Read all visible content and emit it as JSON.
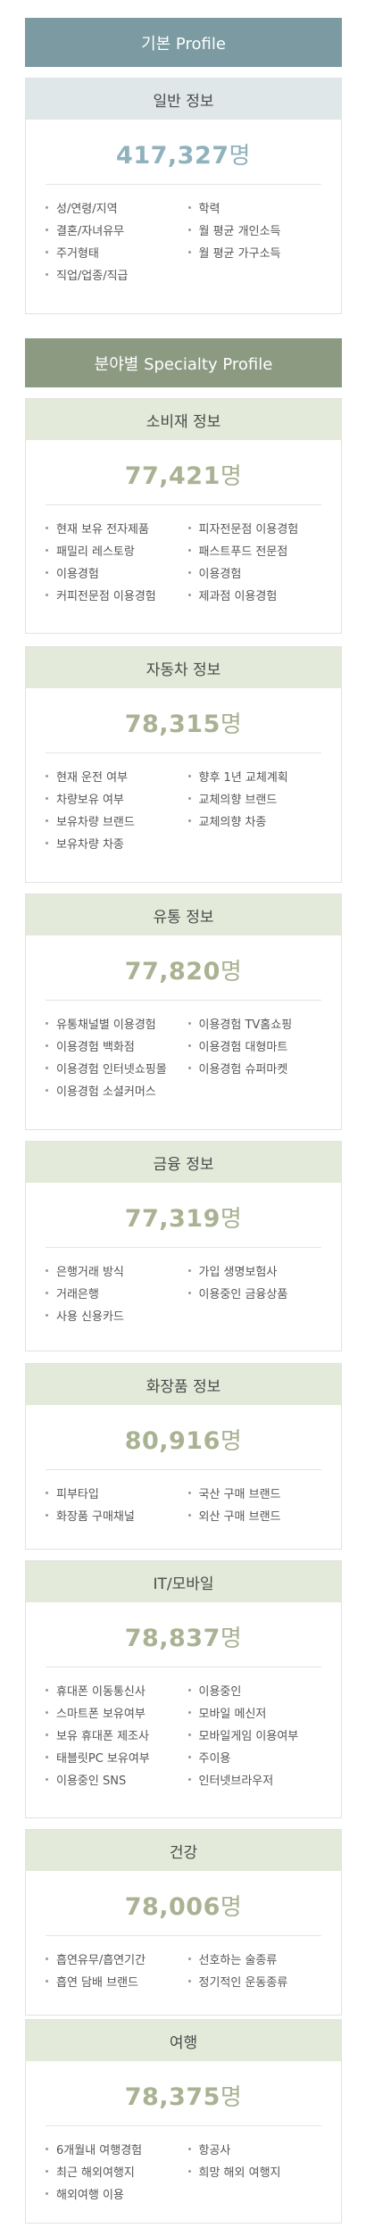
{
  "basic_banner": "기본 Profile",
  "specialty_banner": "분야별 Specialty Profile",
  "cards": [
    {
      "title": "일반 정보",
      "count": "417,327",
      "unit": "명",
      "items": [
        "성/연령/지역",
        "학력",
        "결혼/자녀유무",
        "월 평균 개인소득",
        "주거형태",
        "월 평균 가구소득",
        "직업/업종/직급"
      ]
    },
    {
      "title": "소비재 정보",
      "count": "77,421",
      "unit": "명",
      "items": [
        "현재 보유 전자제품",
        "피자전문점 이용경험",
        "패밀리 레스토랑",
        "패스트푸드 전문점",
        "이용경험",
        "이용경험",
        "커피전문점 이용경험",
        "제과점 이용경험"
      ]
    },
    {
      "title": "자동차 정보",
      "count": "78,315",
      "unit": "명",
      "items": [
        "현재 운전 여부",
        "향후 1년 교체계획",
        "차량보유 여부",
        "교체의향 브랜드",
        "보유차량 브랜드",
        "교체의향 차종",
        "보유차량 차종"
      ]
    },
    {
      "title": "유통 정보",
      "count": "77,820",
      "unit": "명",
      "items": [
        "유통채널별 이용경험",
        "이용경험 TV홈쇼핑",
        "이용경험 백화점",
        "이용경험 대형마트",
        "이용경험 인터넷쇼핑몰",
        "이용경험 슈퍼마켓",
        "이용경험 소셜커머스"
      ]
    },
    {
      "title": "금융 정보",
      "count": "77,319",
      "unit": "명",
      "items": [
        "은행거래 방식",
        "가입 생명보험사",
        "거래은행",
        "이용중인 금융상품",
        "사용 신용카드"
      ]
    },
    {
      "title": "화장품 정보",
      "count": "80,916",
      "unit": "명",
      "items": [
        "피부타입",
        "국산 구매 브랜드",
        "화장품 구매채널",
        "외산 구매 브랜드"
      ]
    },
    {
      "title": "IT/모바일",
      "count": "78,837",
      "unit": "명",
      "items": [
        "휴대폰 이동통신사",
        "이용중인",
        "스마트폰 보유여부",
        "모바일 메신저",
        "보유 휴대폰 제조사",
        "모바일게임 이용여부",
        "태블릿PC 보유여부",
        "주이용",
        "이용중인 SNS",
        "인터넷브라우저"
      ]
    },
    {
      "title": "건강",
      "count": "78,006",
      "unit": "명",
      "items": [
        "흡연유무/흡연기간",
        "선호하는 술종류",
        "흡연 담배 브랜드",
        "정기적인 운동종류"
      ]
    },
    {
      "title": "여행",
      "count": "78,375",
      "unit": "명",
      "items": [
        "6개월내 여행경험",
        "항공사",
        "최근 해외여행지",
        "희망 해외 여행지",
        "해외여행 이용"
      ]
    }
  ]
}
